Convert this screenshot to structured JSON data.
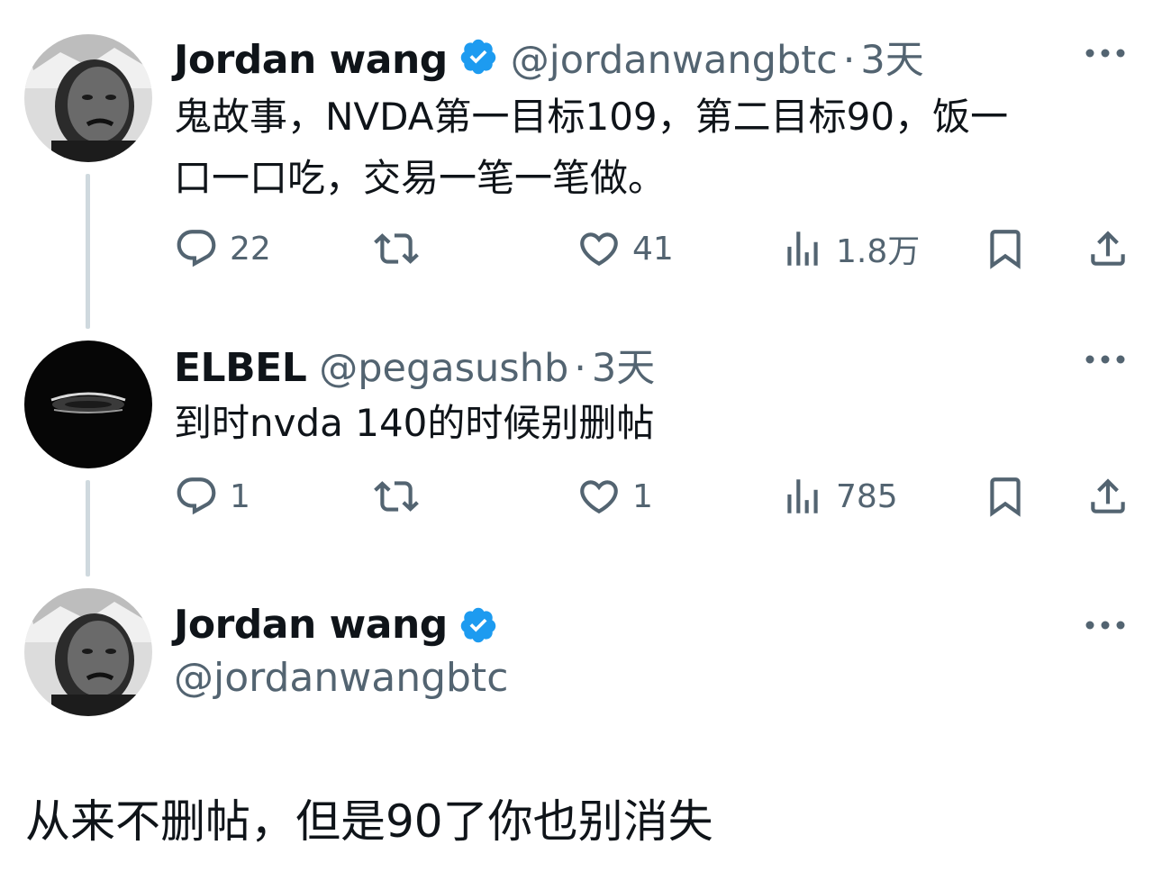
{
  "colors": {
    "text": "#0f1419",
    "secondary": "#536471",
    "verified": "#1d9bf0",
    "thread_line": "#cfd9de"
  },
  "tweet1": {
    "display_name": "Jordan wang",
    "verified_icon": "verified-badge-icon",
    "handle": "@jordanwangbtc",
    "separator": "·",
    "time": "3天",
    "text_line1": "鬼故事，NVDA第一目标109，第二目标90，饭一",
    "text_line2": "口一口吃，交易一笔一笔做。",
    "replies": "22",
    "retweets": "",
    "likes": "41",
    "views": "1.8万"
  },
  "tweet2": {
    "display_name": "ELBEL",
    "handle": "@pegasushb",
    "separator": "·",
    "time": "3天",
    "text_line1": "到时nvda 140的时候别删帖",
    "replies": "1",
    "retweets": "",
    "likes": "1",
    "views": "785"
  },
  "main": {
    "display_name": "Jordan wang",
    "handle": "@jordanwangbtc",
    "text": "从来不删帖，但是90了你也别消失"
  },
  "icons": [
    "reply-icon",
    "retweet-icon",
    "like-icon",
    "views-icon",
    "bookmark-icon",
    "share-icon",
    "more-icon",
    "verified-badge-icon"
  ]
}
